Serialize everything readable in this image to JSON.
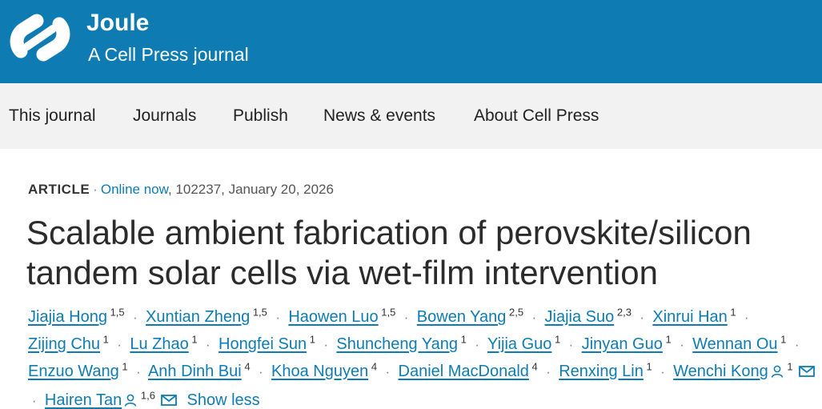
{
  "header": {
    "brand_title": "Joule",
    "brand_subtitle": "A Cell Press journal",
    "logo_icon": "cell-press-logo",
    "color": "#0e7cb3"
  },
  "nav": {
    "items": [
      "This journal",
      "Journals",
      "Publish",
      "News & events",
      "About Cell Press"
    ]
  },
  "article": {
    "type": "ARTICLE",
    "separator": "·",
    "status": "Online now",
    "details": ", 102237, January 20, 2026",
    "title_line1": "Scalable ambient fabrication of perovskite/silicon",
    "title_line2": "tandem solar cells via wet-film intervention"
  },
  "authors": [
    {
      "name": "Jiajia Hong",
      "aff": "1,5"
    },
    {
      "name": "Xuntian Zheng",
      "aff": "1,5"
    },
    {
      "name": "Haowen Luo",
      "aff": "1,5"
    },
    {
      "name": "Bowen Yang",
      "aff": "2,5"
    },
    {
      "name": "Jiajia Suo",
      "aff": "2,3"
    },
    {
      "name": "Xinrui Han",
      "aff": "1"
    },
    {
      "name": "Zijing Chu",
      "aff": "1"
    },
    {
      "name": "Lu Zhao",
      "aff": "1"
    },
    {
      "name": "Hongfei Sun",
      "aff": "1"
    },
    {
      "name": "Shuncheng Yang",
      "aff": "1"
    },
    {
      "name": "Yijia Guo",
      "aff": "1"
    },
    {
      "name": "Jinyan Guo",
      "aff": "1"
    },
    {
      "name": "Wennan Ou",
      "aff": "1"
    },
    {
      "name": "Enzuo Wang",
      "aff": "1"
    },
    {
      "name": "Anh Dinh Bui",
      "aff": "4"
    },
    {
      "name": "Khoa Nguyen",
      "aff": "4"
    },
    {
      "name": "Daniel MacDonald",
      "aff": "4"
    },
    {
      "name": "Renxing Lin",
      "aff": "1"
    },
    {
      "name": "Wenchi Kong",
      "aff": "1",
      "corresponding": true
    },
    {
      "name": "Hairen Tan",
      "aff": "1,6",
      "corresponding": true
    }
  ],
  "author_separator": "·",
  "show_less_label": "Show less",
  "icons": {
    "corresponding": "person-icon",
    "email": "envelope-icon"
  }
}
